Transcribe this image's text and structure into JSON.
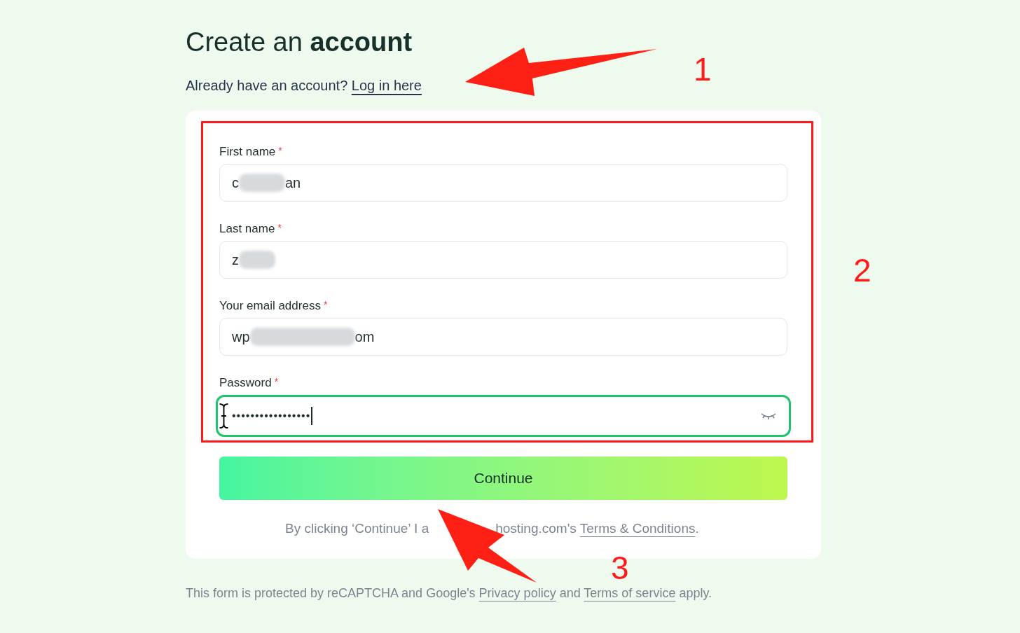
{
  "heading": {
    "plain": "Create an ",
    "bold": "account"
  },
  "login_prompt": {
    "text": "Already have an account? ",
    "link": "Log in here"
  },
  "fields": [
    {
      "label": "First name",
      "required_mark": "*",
      "value_parts": [
        "c",
        "an"
      ],
      "focused": false,
      "kind": "text"
    },
    {
      "label": "Last name",
      "required_mark": "*",
      "value_parts": [
        "z"
      ],
      "focused": false,
      "kind": "text"
    },
    {
      "label": "Your email address",
      "required_mark": "*",
      "value_parts": [
        "wp",
        "om"
      ],
      "focused": false,
      "kind": "text"
    },
    {
      "label": "Password",
      "required_mark": "*",
      "value_parts": [
        "•••••••••••••••••"
      ],
      "focused": true,
      "kind": "password"
    }
  ],
  "continue_button": "Continue",
  "terms": {
    "text": "By clicking ‘Continue’ I a",
    "text_after": "hosting.com's ",
    "link": "Terms & Conditions",
    "end": "."
  },
  "footer": {
    "text": "This form is protected by reCAPTCHA and Google's ",
    "link1": "Privacy policy",
    "middle": " and ",
    "link2": "Terms of service",
    "end": " apply."
  },
  "annotations": [
    "1",
    "2",
    "3"
  ]
}
